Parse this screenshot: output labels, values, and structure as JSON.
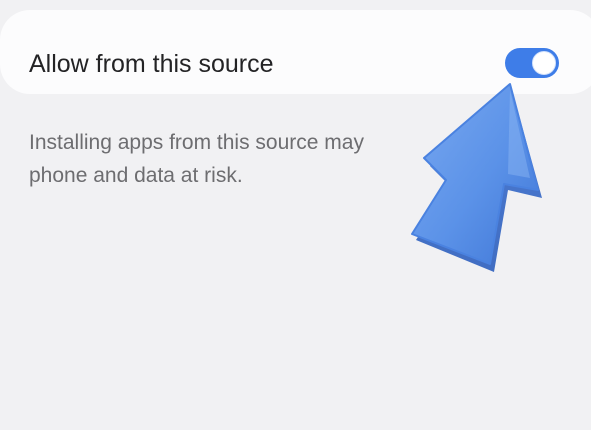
{
  "setting": {
    "label": "Allow from this source",
    "toggle_state": "on"
  },
  "warning": {
    "line1": "Installing apps from this source may",
    "line2": "phone and data at risk."
  },
  "colors": {
    "background": "#f1f1f3",
    "card": "#fcfcfd",
    "toggle_on": "#3e7de8",
    "arrow": "#5b92e8"
  },
  "icons": {
    "pointer": "arrow-up-icon"
  }
}
